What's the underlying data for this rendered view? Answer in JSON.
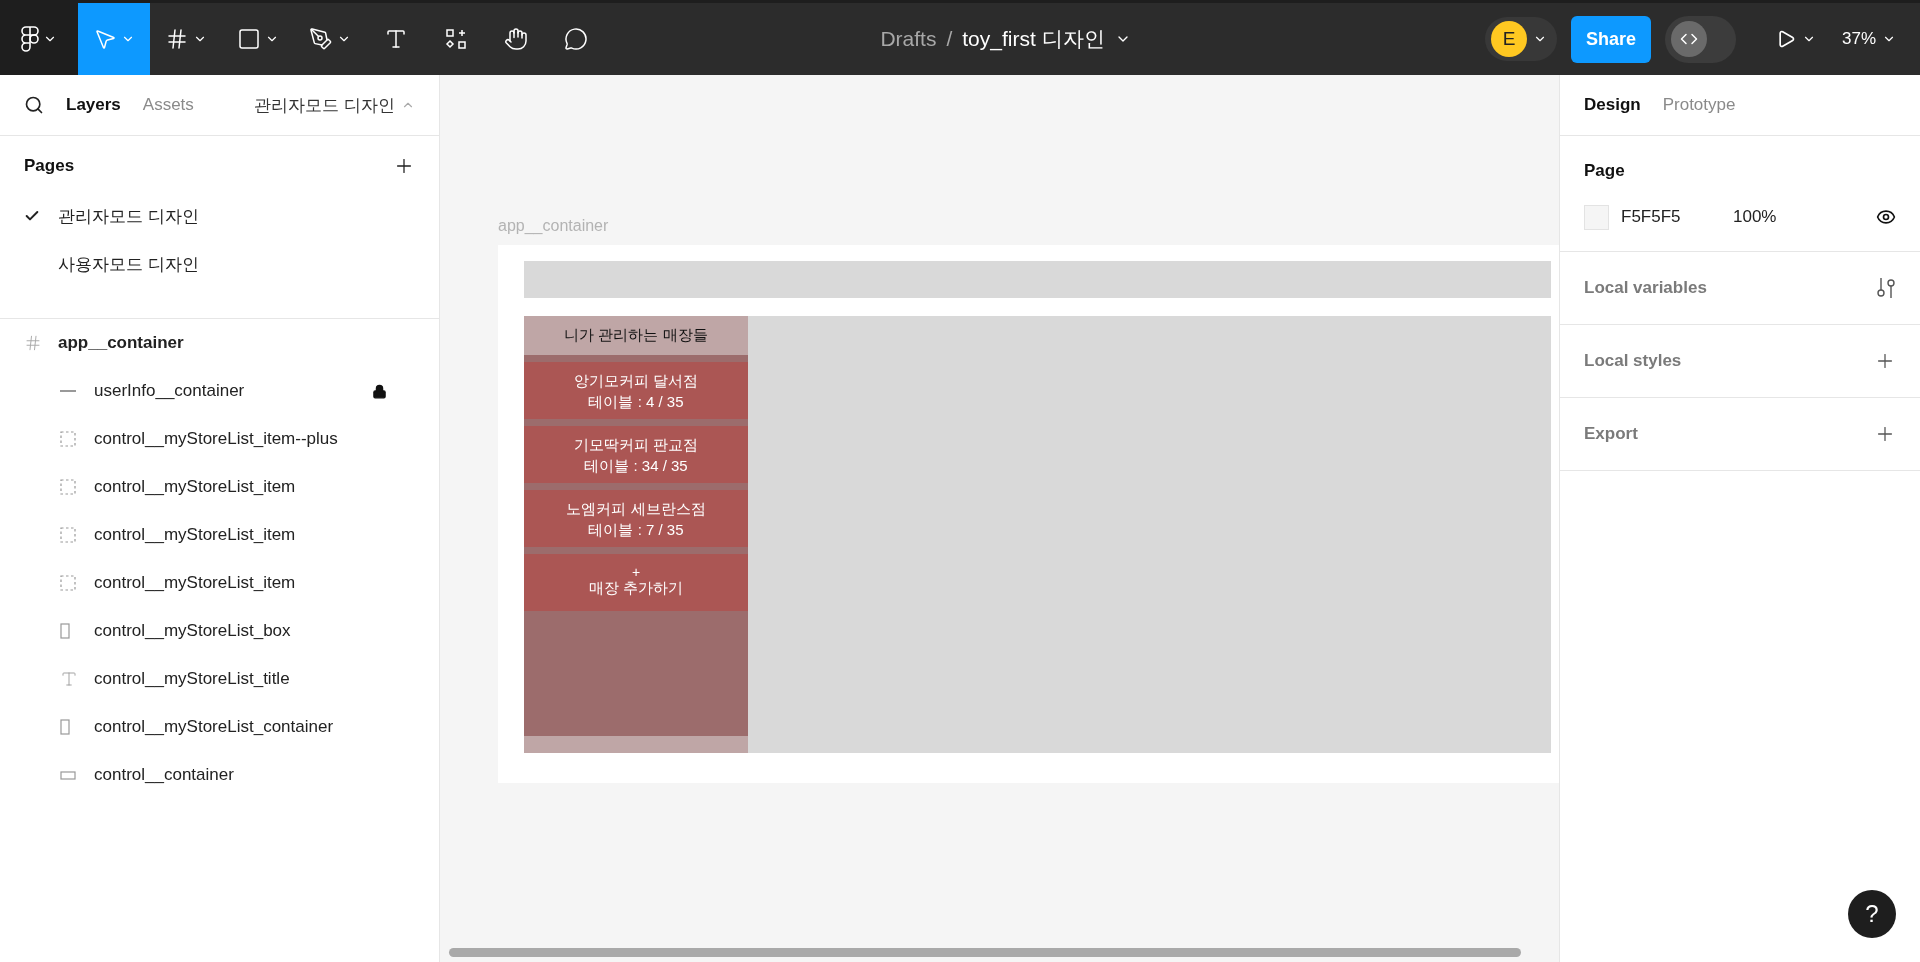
{
  "toolbar": {
    "tools": [
      {
        "kind": "move",
        "selected": true,
        "caret": true
      },
      {
        "kind": "frame",
        "selected": false,
        "caret": true
      },
      {
        "kind": "shape",
        "selected": false,
        "caret": true
      },
      {
        "kind": "pen",
        "selected": false,
        "caret": true
      },
      {
        "kind": "text",
        "selected": false,
        "caret": false
      },
      {
        "kind": "resources",
        "selected": false,
        "caret": false
      },
      {
        "kind": "hand",
        "selected": false,
        "caret": false
      },
      {
        "kind": "comment",
        "selected": false,
        "caret": false
      }
    ],
    "breadcrumb": {
      "folder": "Drafts",
      "separator": "/",
      "file": "toy_first 디자인"
    },
    "avatar": {
      "initial": "E",
      "color": "#ffc821"
    },
    "share": "Share",
    "dev_mode": {
      "on": false
    },
    "zoom": "37%"
  },
  "left_panel": {
    "tabs": [
      {
        "label": "Layers",
        "selected": true
      },
      {
        "label": "Assets",
        "selected": false
      }
    ],
    "page_switcher": "관리자모드 디자인",
    "pages_title": "Pages",
    "pages": [
      {
        "label": "관리자모드 디자인",
        "selected": true
      },
      {
        "label": "사용자모드 디자인",
        "selected": false
      }
    ],
    "layers": [
      {
        "name": "app__container",
        "kind": "frame",
        "locked": false,
        "children": [
          {
            "name": "userInfo__container",
            "kind": "line",
            "locked": true
          },
          {
            "name": "control__myStoreList_item--plus",
            "kind": "group",
            "locked": false
          },
          {
            "name": "control__myStoreList_item",
            "kind": "group",
            "locked": false
          },
          {
            "name": "control__myStoreList_item",
            "kind": "group",
            "locked": false
          },
          {
            "name": "control__myStoreList_item",
            "kind": "group",
            "locked": false
          },
          {
            "name": "control__myStoreList_box",
            "kind": "tall-rect",
            "locked": false
          },
          {
            "name": "control__myStoreList_title",
            "kind": "text",
            "locked": false
          },
          {
            "name": "control__myStoreList_container",
            "kind": "tall-rect",
            "locked": false
          },
          {
            "name": "control__container",
            "kind": "wide-rect",
            "locked": false
          }
        ]
      }
    ]
  },
  "canvas": {
    "frame_label": "app__container",
    "store_list": {
      "title": "니가 관리하는 매장들",
      "items": [
        {
          "kind": "store",
          "name": "앙기모커피 달서점",
          "tables": "테이블 : 4 / 35"
        },
        {
          "kind": "store",
          "name": "기모딱커피 판교점",
          "tables": "테이블 : 34 / 35"
        },
        {
          "kind": "store",
          "name": "노엠커피 세브란스점",
          "tables": "테이블 : 7 / 35"
        },
        {
          "kind": "add",
          "icon": "+",
          "label": "매장 추가하기"
        }
      ]
    }
  },
  "right_panel": {
    "tabs": [
      {
        "label": "Design",
        "selected": true
      },
      {
        "label": "Prototype",
        "selected": false
      }
    ],
    "page": {
      "title": "Page",
      "color": "F5F5F5",
      "opacity": "100%"
    },
    "sections": [
      {
        "label": "Local variables",
        "kind": "variables"
      },
      {
        "label": "Local styles",
        "kind": "add"
      },
      {
        "label": "Export",
        "kind": "add"
      }
    ]
  },
  "help": "?"
}
